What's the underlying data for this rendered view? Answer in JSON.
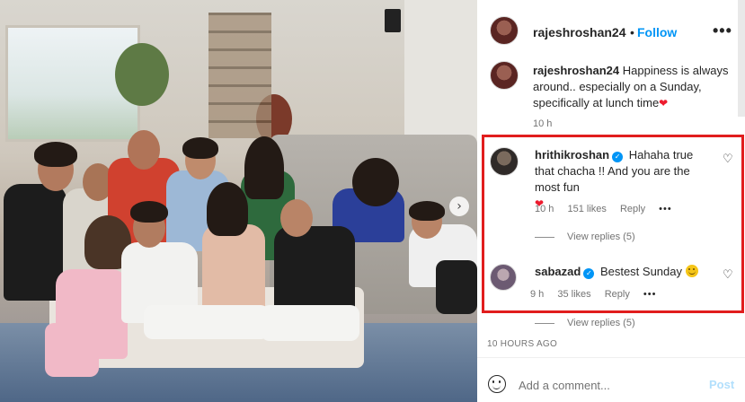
{
  "post": {
    "username": "rajeshroshan24",
    "dot": "•",
    "follow_label": "Follow",
    "more_icon": "more-options-icon",
    "caption": {
      "username": "rajeshroshan24",
      "text": "Happiness is always around.. especially on a Sunday, specifically at lunch time",
      "emoji": "❤"
    },
    "caption_time": "10 h"
  },
  "comments": [
    {
      "username": "hrithikroshan",
      "verified": true,
      "text": "Hahaha true that chacha !! And you are the most fun",
      "emoji": "❤",
      "time": "10 h",
      "likes": "151 likes",
      "reply_label": "Reply",
      "more": "•••",
      "view_replies": "View replies (5)"
    },
    {
      "username": "sabazad",
      "verified": true,
      "text": "Bestest Sunday",
      "emoji": "smiling-face",
      "time": "9 h",
      "likes": "35 likes",
      "reply_label": "Reply",
      "more": "•••",
      "view_replies": "View replies (5)"
    }
  ],
  "footer": {
    "timestamp": "10 HOURS AGO",
    "comment_placeholder": "Add a comment...",
    "post_label": "Post"
  },
  "carousel_next": "›",
  "colors": {
    "follow": "#0095f6",
    "highlight_box": "#e11d1d",
    "heart": "#ed1b2e",
    "post_disabled": "#b2dffc"
  }
}
